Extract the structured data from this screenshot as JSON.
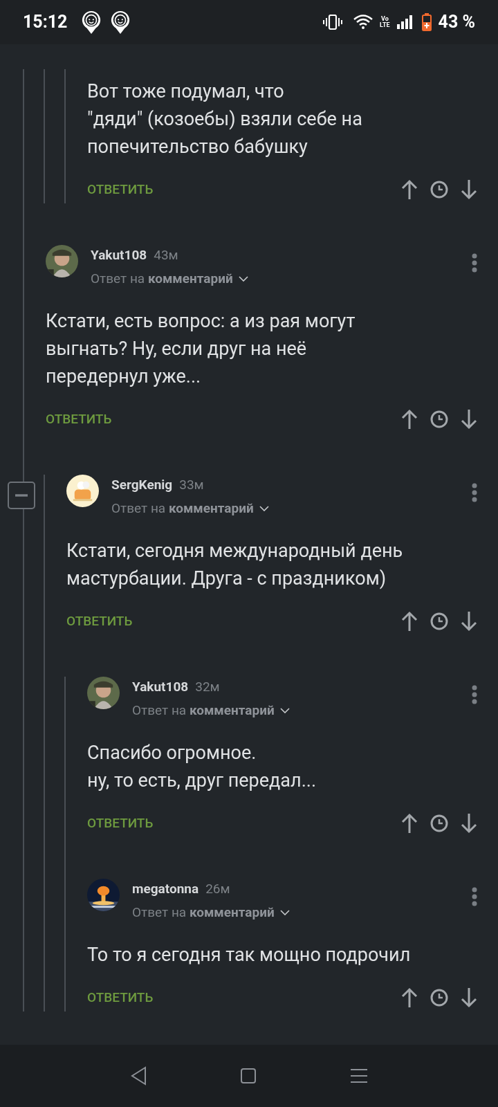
{
  "status_bar": {
    "time": "15:12",
    "network_badge": [
      "Vo",
      "LTE"
    ],
    "battery": "43 %"
  },
  "thread": [
    {
      "children": [
        {
          "children": [
            {
              "body": [
                "Вот тоже подумал, что",
                "\"дяди\" (козоебы) взяли себе на",
                "попечительство бабушку"
              ],
              "reply_button": "ОТВЕТИТЬ"
            }
          ]
        }
      ]
    },
    {
      "author": "Yakut108",
      "time": "43м",
      "avatar": {
        "kind": "picture"
      },
      "reply_to": [
        "Ответ на",
        "комментарий"
      ],
      "body": [
        "Кстати, есть вопрос: а из рая могут",
        "выгнать? Ну, если друг на неё",
        "передернул уже..."
      ],
      "reply_button": "ОТВЕТИТЬ",
      "children": [
        {
          "author": "SergKenig",
          "time": "33м",
          "avatar": {
            "kind": "picture"
          },
          "expanded": true,
          "reply_to": [
            "Ответ на",
            "комментарий"
          ],
          "body": [
            "Кстати, сегодня международный день",
            "мастурбации. Друга - с праздником)"
          ],
          "reply_button": "ОТВЕТИТЬ",
          "children": [
            {
              "author": "Yakut108",
              "time": "32м",
              "avatar": {
                "kind": "picture"
              },
              "reply_to": [
                "Ответ на",
                "комментарий"
              ],
              "body": [
                "Спасибо огромное.",
                "ну, то есть, друг передал..."
              ],
              "reply_button": "ОТВЕТИТЬ"
            },
            {
              "author": "megatonna",
              "time": "26м",
              "avatar": {
                "kind": "picture"
              },
              "reply_to": [
                "Ответ на",
                "комментарий"
              ],
              "body": [
                "То то я сегодня так мощно подрочил"
              ],
              "reply_button": "ОТВЕТИТЬ"
            }
          ]
        }
      ]
    }
  ]
}
